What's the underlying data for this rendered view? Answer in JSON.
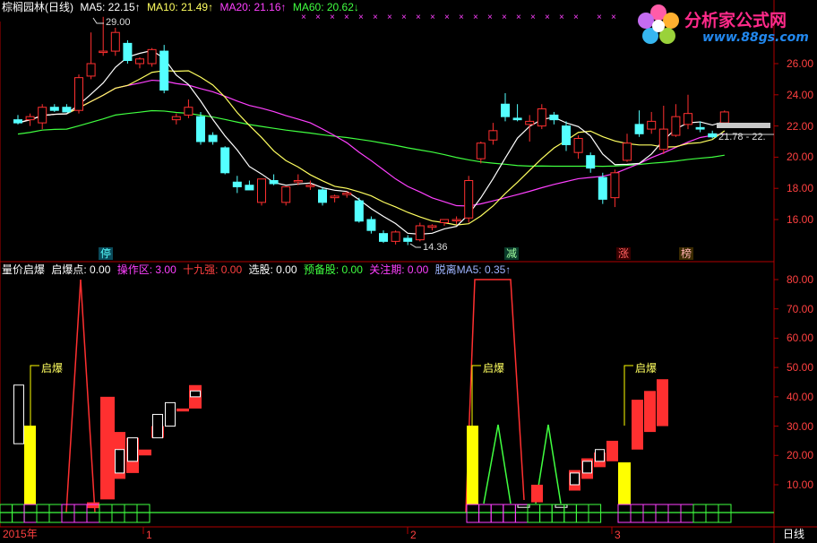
{
  "main_header": {
    "stock": "棕榈园林(日线)",
    "ma5_label": "MA5: 22.15↑",
    "ma10_label": "MA10: 21.49↑",
    "ma20_label": "MA20: 21.16↑",
    "ma60_label": "MA60: 20.62↓",
    "ma_colors": {
      "ma5": "#ffffff",
      "ma10": "#ffff60",
      "ma20": "#ff40ff",
      "ma60": "#40ff40"
    }
  },
  "logo": {
    "title": "分析家公式网",
    "url": "www.88gs.com"
  },
  "main_annotations": {
    "high_marker": "29.00",
    "low_marker": "14.36",
    "range_label": "21.78 - 22.",
    "tags": [
      "停",
      "减",
      "涨",
      "榜"
    ]
  },
  "main_axis": {
    "ticks": [
      "26.00",
      "24.00",
      "22.00",
      "20.00",
      "18.00",
      "16.00"
    ]
  },
  "sub_header": {
    "name": "量价启爆",
    "items": [
      {
        "label": "启爆点: 0.00",
        "color": "#ffffff"
      },
      {
        "label": "操作区: 3.00",
        "color": "#ff40ff"
      },
      {
        "label": "十九强: 0.00",
        "color": "#ff4040"
      },
      {
        "label": "选股: 0.00",
        "color": "#ffffff"
      },
      {
        "label": "预备股: 0.00",
        "color": "#40ff40"
      },
      {
        "label": "关注期: 0.00",
        "color": "#ff40ff"
      },
      {
        "label": "脱离MA5: 0.35↑",
        "color": "#9fb4ff"
      }
    ]
  },
  "sub_annotations": {
    "qibao": "启爆"
  },
  "sub_axis": {
    "ticks": [
      "80.00",
      "70.00",
      "60.00",
      "50.00",
      "40.00",
      "30.00",
      "20.00",
      "10.00"
    ]
  },
  "time_axis": {
    "labels": [
      "2015年",
      "1",
      "2",
      "3"
    ],
    "period": "日线"
  },
  "colors": {
    "up": "#ff3030",
    "down": "#54ffff",
    "bg": "#000000",
    "axis": "#b00000"
  },
  "chart_data": {
    "type": "candlestick",
    "ylim": [
      14,
      29
    ],
    "candles": [
      {
        "o": 22.4,
        "h": 22.7,
        "l": 22.1,
        "c": 22.2
      },
      {
        "o": 22.4,
        "h": 22.8,
        "l": 22.0,
        "c": 22.6
      },
      {
        "o": 22.2,
        "h": 23.4,
        "l": 21.8,
        "c": 23.2
      },
      {
        "o": 23.2,
        "h": 23.4,
        "l": 22.9,
        "c": 23.0
      },
      {
        "o": 23.2,
        "h": 23.4,
        "l": 22.9,
        "c": 22.9
      },
      {
        "o": 23.0,
        "h": 25.3,
        "l": 22.8,
        "c": 25.1
      },
      {
        "o": 25.2,
        "h": 28.0,
        "l": 25.0,
        "c": 26.0
      },
      {
        "o": 26.8,
        "h": 29.0,
        "l": 26.5,
        "c": 26.8
      },
      {
        "o": 26.8,
        "h": 28.3,
        "l": 26.5,
        "c": 28.0
      },
      {
        "o": 27.3,
        "h": 27.5,
        "l": 26.0,
        "c": 26.2
      },
      {
        "o": 26.0,
        "h": 26.4,
        "l": 25.7,
        "c": 26.3
      },
      {
        "o": 26.0,
        "h": 27.0,
        "l": 25.8,
        "c": 26.9
      },
      {
        "o": 26.8,
        "h": 27.2,
        "l": 24.1,
        "c": 24.3
      },
      {
        "o": 22.4,
        "h": 22.8,
        "l": 22.1,
        "c": 22.6
      },
      {
        "o": 22.7,
        "h": 23.7,
        "l": 22.5,
        "c": 23.2
      },
      {
        "o": 22.6,
        "h": 22.9,
        "l": 20.8,
        "c": 21.0
      },
      {
        "o": 21.4,
        "h": 21.6,
        "l": 20.8,
        "c": 21.0
      },
      {
        "o": 20.6,
        "h": 20.7,
        "l": 18.9,
        "c": 19.0
      },
      {
        "o": 18.4,
        "h": 18.8,
        "l": 17.7,
        "c": 18.1
      },
      {
        "o": 18.2,
        "h": 18.5,
        "l": 17.9,
        "c": 17.9
      },
      {
        "o": 17.1,
        "h": 18.6,
        "l": 16.9,
        "c": 18.6
      },
      {
        "o": 18.5,
        "h": 18.9,
        "l": 18.2,
        "c": 18.3
      },
      {
        "o": 17.1,
        "h": 18.1,
        "l": 16.9,
        "c": 18.1
      },
      {
        "o": 18.5,
        "h": 18.9,
        "l": 18.2,
        "c": 18.5
      },
      {
        "o": 18.2,
        "h": 18.5,
        "l": 17.9,
        "c": 18.2
      },
      {
        "o": 17.9,
        "h": 18.1,
        "l": 16.9,
        "c": 17.1
      },
      {
        "o": 17.4,
        "h": 17.6,
        "l": 17.1,
        "c": 17.5
      },
      {
        "o": 17.6,
        "h": 17.8,
        "l": 17.4,
        "c": 17.7
      },
      {
        "o": 17.2,
        "h": 17.4,
        "l": 15.8,
        "c": 15.9
      },
      {
        "o": 16.0,
        "h": 16.2,
        "l": 15.1,
        "c": 15.3
      },
      {
        "o": 15.1,
        "h": 15.3,
        "l": 14.5,
        "c": 14.6
      },
      {
        "o": 14.6,
        "h": 15.3,
        "l": 14.4,
        "c": 15.2
      },
      {
        "o": 14.8,
        "h": 15.0,
        "l": 14.36,
        "c": 14.6
      },
      {
        "o": 14.7,
        "h": 15.8,
        "l": 14.6,
        "c": 15.6
      },
      {
        "o": 15.5,
        "h": 15.7,
        "l": 15.3,
        "c": 15.6
      },
      {
        "o": 15.8,
        "h": 16.0,
        "l": 15.6,
        "c": 16.0
      },
      {
        "o": 16.0,
        "h": 16.2,
        "l": 15.7,
        "c": 16.0
      },
      {
        "o": 16.1,
        "h": 18.8,
        "l": 15.8,
        "c": 18.5
      },
      {
        "o": 19.9,
        "h": 21.0,
        "l": 19.6,
        "c": 20.9
      },
      {
        "o": 21.1,
        "h": 22.2,
        "l": 20.8,
        "c": 21.7
      },
      {
        "o": 23.4,
        "h": 24.1,
        "l": 22.3,
        "c": 22.6
      },
      {
        "o": 22.5,
        "h": 23.4,
        "l": 22.3,
        "c": 22.4
      },
      {
        "o": 22.1,
        "h": 22.7,
        "l": 21.0,
        "c": 22.3
      },
      {
        "o": 22.0,
        "h": 23.4,
        "l": 21.8,
        "c": 23.1
      },
      {
        "o": 22.7,
        "h": 22.9,
        "l": 22.1,
        "c": 22.4
      },
      {
        "o": 22.0,
        "h": 22.3,
        "l": 20.4,
        "c": 20.8
      },
      {
        "o": 20.3,
        "h": 21.4,
        "l": 19.9,
        "c": 21.2
      },
      {
        "o": 20.1,
        "h": 20.3,
        "l": 19.0,
        "c": 19.3
      },
      {
        "o": 18.7,
        "h": 19.0,
        "l": 17.0,
        "c": 17.3
      },
      {
        "o": 17.4,
        "h": 19.2,
        "l": 16.8,
        "c": 19.0
      },
      {
        "o": 19.8,
        "h": 21.5,
        "l": 19.7,
        "c": 20.9
      },
      {
        "o": 22.1,
        "h": 23.0,
        "l": 21.3,
        "c": 21.5
      },
      {
        "o": 21.8,
        "h": 22.9,
        "l": 21.5,
        "c": 22.3
      },
      {
        "o": 20.5,
        "h": 23.3,
        "l": 20.2,
        "c": 21.8
      },
      {
        "o": 21.4,
        "h": 23.4,
        "l": 21.3,
        "c": 22.6
      },
      {
        "o": 22.1,
        "h": 24.0,
        "l": 21.8,
        "c": 22.8
      },
      {
        "o": 21.9,
        "h": 22.3,
        "l": 21.6,
        "c": 21.8
      },
      {
        "o": 21.5,
        "h": 21.7,
        "l": 21.2,
        "c": 21.3
      },
      {
        "o": 22.2,
        "h": 23.0,
        "l": 22.0,
        "c": 22.9
      }
    ]
  }
}
